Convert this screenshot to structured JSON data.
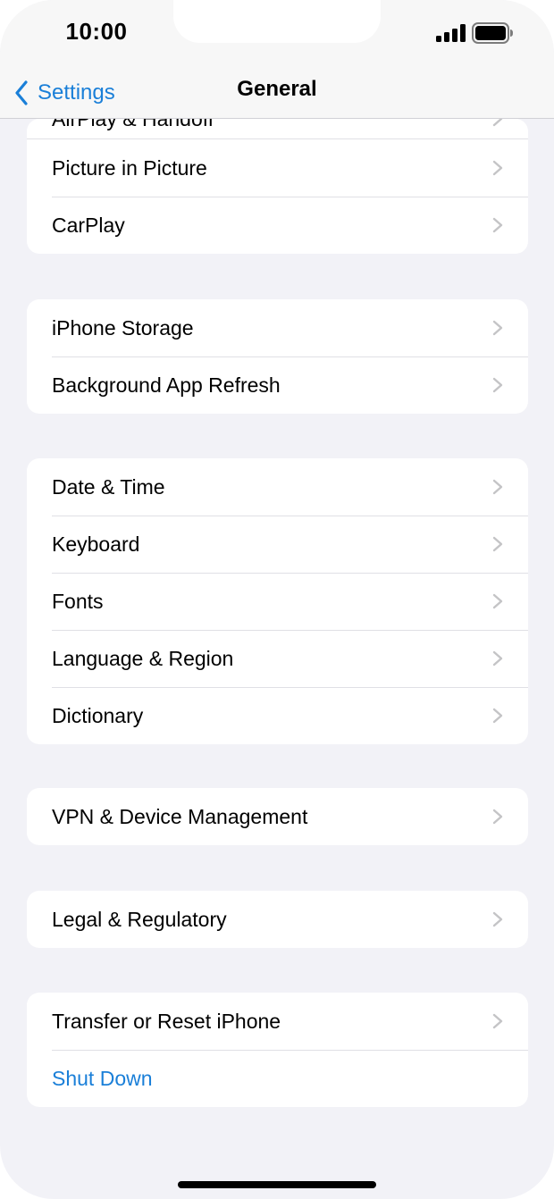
{
  "status_bar": {
    "time": "10:00",
    "signal_icon": "cellular-signal-icon",
    "battery_icon": "battery-full-icon"
  },
  "nav": {
    "back_label": "Settings",
    "back_icon": "chevron-left-icon",
    "title": "General"
  },
  "groups": [
    {
      "items": [
        {
          "label": "AirPlay & Handoff",
          "partial": true
        },
        {
          "label": "Picture in Picture"
        },
        {
          "label": "CarPlay"
        }
      ]
    },
    {
      "items": [
        {
          "label": "iPhone Storage"
        },
        {
          "label": "Background App Refresh"
        }
      ]
    },
    {
      "items": [
        {
          "label": "Date & Time"
        },
        {
          "label": "Keyboard"
        },
        {
          "label": "Fonts"
        },
        {
          "label": "Language & Region"
        },
        {
          "label": "Dictionary"
        }
      ]
    },
    {
      "items": [
        {
          "label": "VPN & Device Management"
        }
      ]
    },
    {
      "items": [
        {
          "label": "Legal & Regulatory"
        }
      ]
    },
    {
      "items": [
        {
          "label": "Transfer or Reset iPhone"
        },
        {
          "label": "Shut Down",
          "style": "link"
        }
      ]
    }
  ],
  "colors": {
    "accent": "#1a7fd8",
    "background": "#f2f2f7",
    "cell": "#ffffff",
    "chevron": "#c4c4c6"
  }
}
